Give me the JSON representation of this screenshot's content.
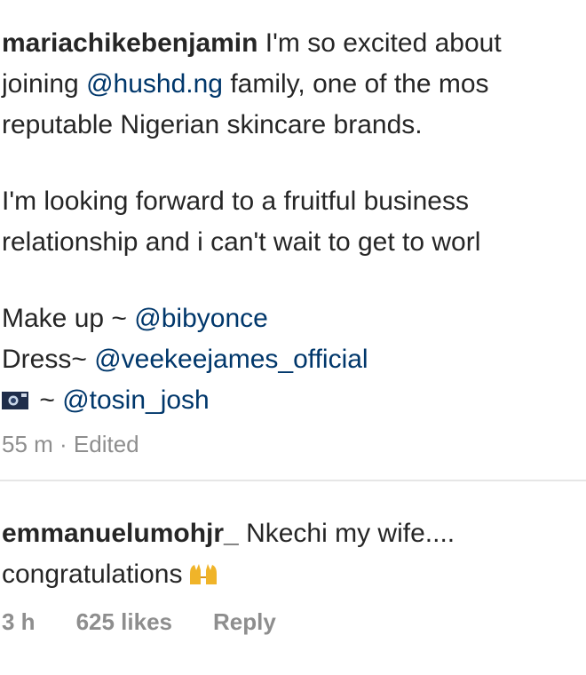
{
  "post": {
    "username": "mariachikebenjamin",
    "line1_text": " I'm so excited about",
    "line2_prefix": "joining ",
    "line2_mention": "@hushd.ng",
    "line2_suffix": " family, one of the mos",
    "line3": "reputable Nigerian skincare brands.",
    "line4": "I'm looking forward to a fruitful business",
    "line5": "relationship and i can't wait to get to worl",
    "credit1_label": "Make up ~ ",
    "credit1_mention": "@bibyonce",
    "credit2_label": "Dress~ ",
    "credit2_mention": "@veekeejames_official",
    "credit3_label": " ~ ",
    "credit3_mention": "@tosin_josh",
    "credit3_icon": "camera-icon",
    "time": "55 m",
    "separator": " · ",
    "edited": "Edited"
  },
  "comment": {
    "username": "emmanuelumohjr_",
    "text_line1": " Nkechi my wife....",
    "text_line2": "congratulations",
    "emoji": "raising-hands-icon",
    "time": "3 h",
    "likes": "625 likes",
    "reply": "Reply"
  },
  "colors": {
    "text": "#262626",
    "mention": "#00376b",
    "meta": "#8e8e8e",
    "divider": "#e6e6e6"
  }
}
